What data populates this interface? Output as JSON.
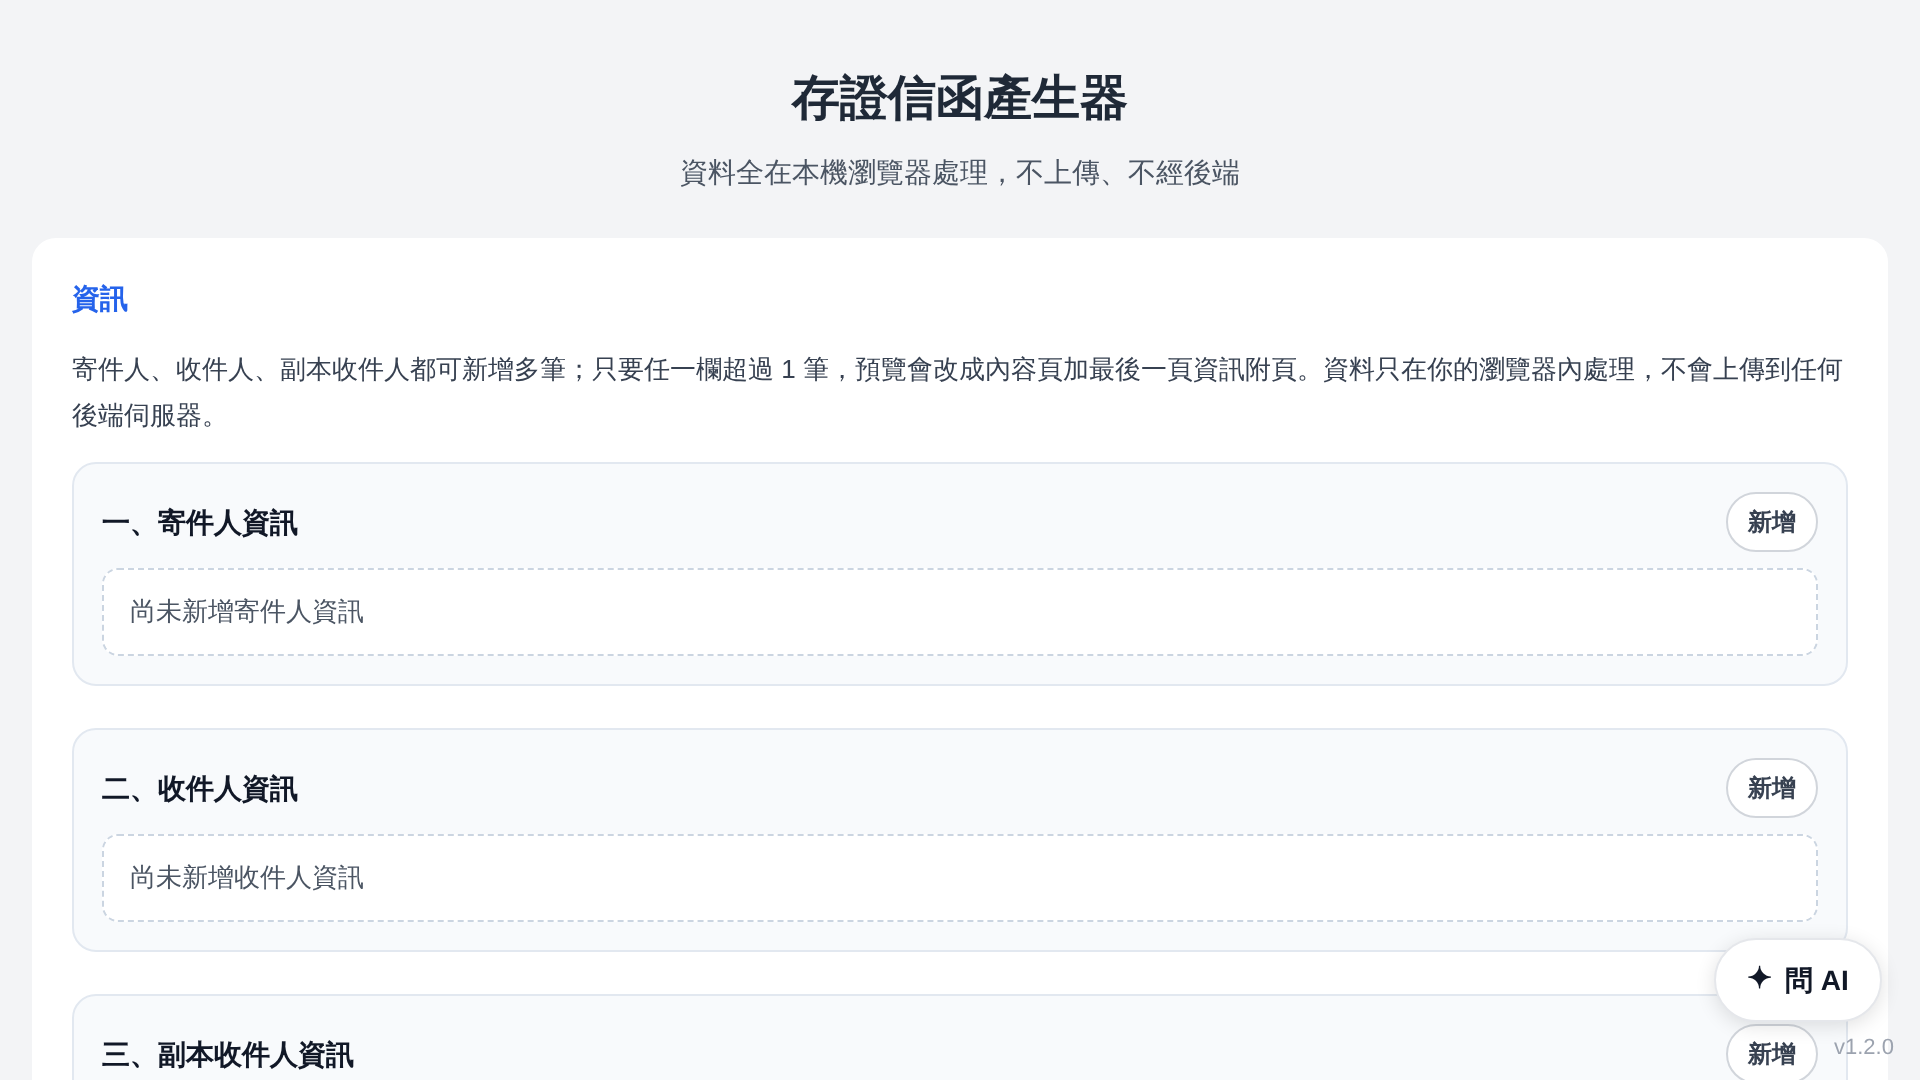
{
  "header": {
    "title": "存證信函產生器",
    "subtitle": "資料全在本機瀏覽器處理，不上傳、不經後端"
  },
  "info": {
    "heading": "資訊",
    "text": "寄件人、收件人、副本收件人都可新增多筆；只要任一欄超過 1 筆，預覽會改成內容頁加最後一頁資訊附頁。資料只在你的瀏覽器內處理，不會上傳到任何後端伺服器。"
  },
  "sections": [
    {
      "title": "一、寄件人資訊",
      "button": "新增",
      "empty": "尚未新增寄件人資訊"
    },
    {
      "title": "二、收件人資訊",
      "button": "新增",
      "empty": "尚未新增收件人資訊"
    },
    {
      "title": "三、副本收件人資訊",
      "button": "新增"
    }
  ],
  "ask_button": {
    "icon": "✦",
    "label": "問 AI"
  },
  "version": "v1.2.0"
}
